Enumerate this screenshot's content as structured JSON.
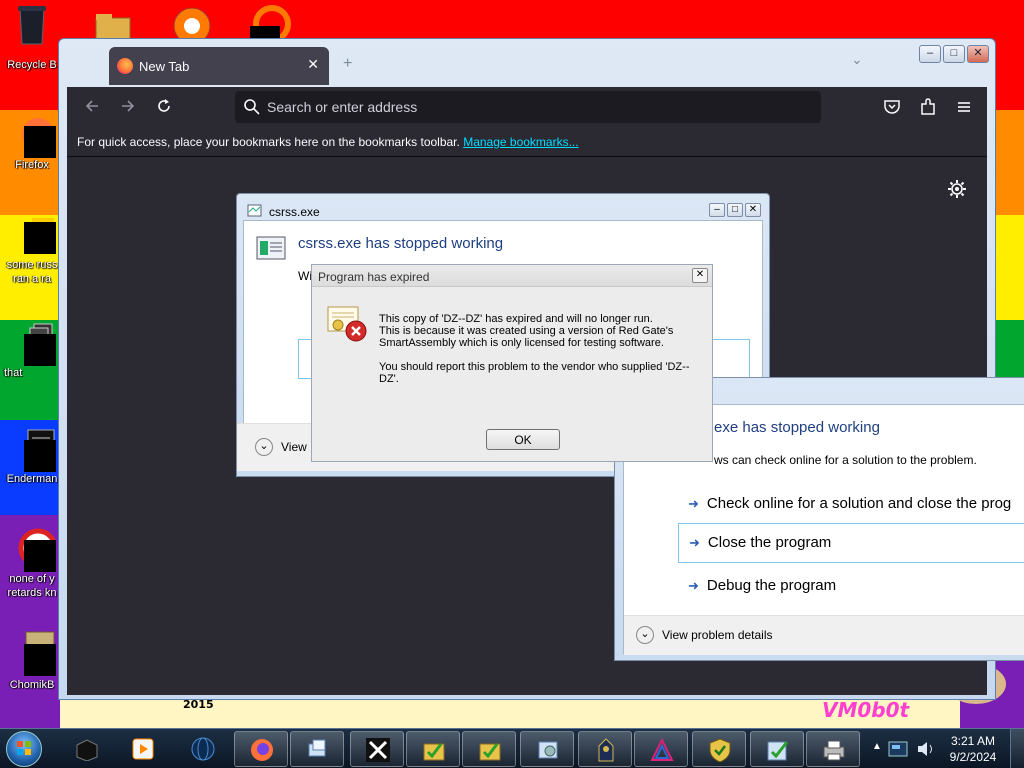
{
  "desktop": {
    "icons": [
      {
        "label": "Recycle B"
      },
      {
        "label": "Firefox"
      },
      {
        "label": "some russ\nran a ra"
      },
      {
        "label": "that"
      },
      {
        "label": "Enderman"
      },
      {
        "label": "none of y\nretards kn"
      },
      {
        "label": "ChomikB"
      }
    ],
    "wallpaper_text": {
      "year": "2015",
      "brand": "VM0b0t"
    },
    "wallpaper_colors": [
      "#ff0000",
      "#ff8c00",
      "#ffee00",
      "#00a62e",
      "#0a3cff",
      "#7a1fb5"
    ]
  },
  "browser": {
    "tab_label": "New Tab",
    "tab_close": "✕",
    "window_controls": {
      "minimize": "–",
      "maximize": "□",
      "close": "✕"
    },
    "new_tab": "+",
    "overflow": "⌄",
    "address_placeholder": "Search or enter address",
    "bookmarks_message": "For quick access, place your bookmarks here on the bookmarks toolbar.",
    "bookmarks_link": "Manage bookmarks...",
    "accent": "#00ddff"
  },
  "csrss_back": {
    "title": "csrss.exe",
    "controls": {
      "minimize": "–",
      "maximize": "□",
      "close": "✕"
    },
    "heading": "csrss.exe has stopped working",
    "line_fragment": "Wi",
    "view_label": "View"
  },
  "csrss_front": {
    "heading": "exe has stopped working",
    "subtext": "ws can check online for a solution to the problem.",
    "options": [
      {
        "arrow": "➜",
        "label": "Check online for a solution and close the prog"
      },
      {
        "arrow": "➜",
        "label": "Close the program"
      },
      {
        "arrow": "➜",
        "label": "Debug the program"
      }
    ],
    "details_label": "View problem details",
    "details_chevron": "⌄"
  },
  "expired_dialog": {
    "title": "Program has expired",
    "close": "✕",
    "message_1": "This copy of 'DZ--DZ' has expired and will no longer run.",
    "message_2": "This is because it was created using a version of Red Gate's SmartAssembly which is only licensed for testing software.",
    "message_3": "You should report this problem to the vendor who supplied 'DZ--DZ'.",
    "ok_label": "OK"
  },
  "taskbar": {
    "items": [
      {
        "icon": "black-box-icon"
      },
      {
        "icon": "media-player-icon"
      },
      {
        "icon": "globe-icon"
      },
      {
        "icon": "firefox-icon"
      },
      {
        "icon": "network-icon"
      },
      {
        "icon": "x-app-icon"
      },
      {
        "icon": "installer-icon"
      },
      {
        "icon": "installer-icon"
      },
      {
        "icon": "settings-tool-icon"
      },
      {
        "icon": "clock-tower-icon"
      },
      {
        "icon": "triangle-logo-icon"
      },
      {
        "icon": "shield-icon"
      },
      {
        "icon": "installer-check-icon"
      },
      {
        "icon": "printer-icon"
      }
    ],
    "tray_arrow": "▲",
    "time": "3:21 AM",
    "date": "9/2/2024"
  }
}
